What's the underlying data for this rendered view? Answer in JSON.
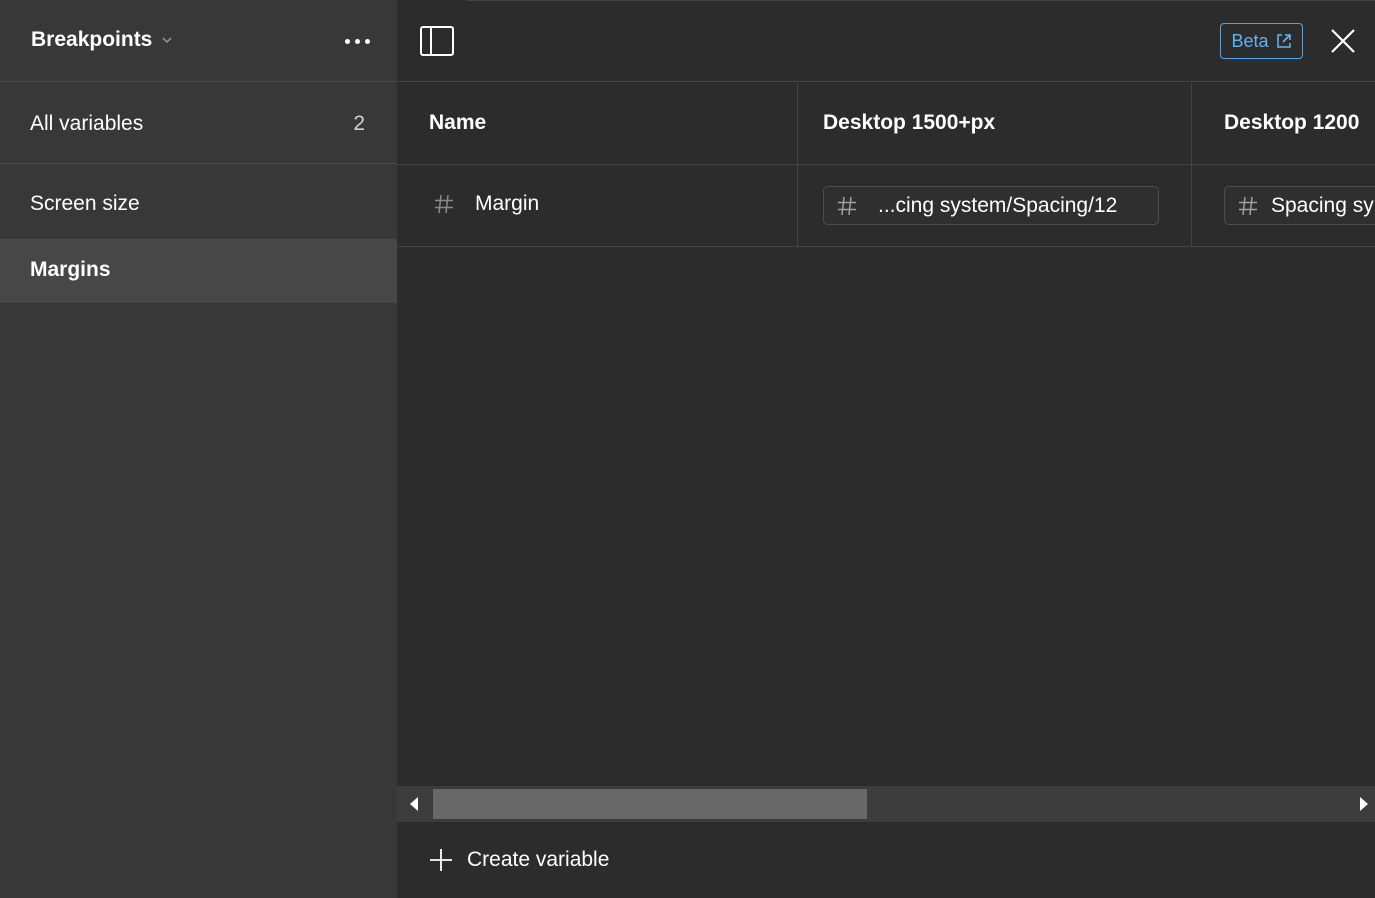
{
  "sidebar": {
    "collection_title": "Breakpoints",
    "all_variables": {
      "label": "All variables",
      "count": "2"
    },
    "groups": [
      {
        "label": "Screen size"
      },
      {
        "label": "Margins",
        "selected": true
      }
    ]
  },
  "toolbar": {
    "beta_label": "Beta"
  },
  "table": {
    "columns": [
      "Name",
      "Desktop 1500+px",
      "Desktop 1200"
    ],
    "rows": [
      {
        "name": "Margin",
        "values": [
          "...cing system/Spacing/12",
          "Spacing sy"
        ]
      }
    ]
  },
  "footer": {
    "create_label": "Create variable"
  },
  "scrollbar": {
    "position_fraction": 0.0
  },
  "colors": {
    "sidebar_bg": "#383838",
    "main_bg": "#2c2c2c",
    "selected_bg": "#474747",
    "accent": "#4aa6ee"
  },
  "icons": {
    "more": "more-horizontal-icon",
    "panel": "sidebar-panel-icon",
    "close": "close-icon",
    "external": "external-link-icon",
    "number": "hash-icon",
    "plus": "plus-icon"
  }
}
